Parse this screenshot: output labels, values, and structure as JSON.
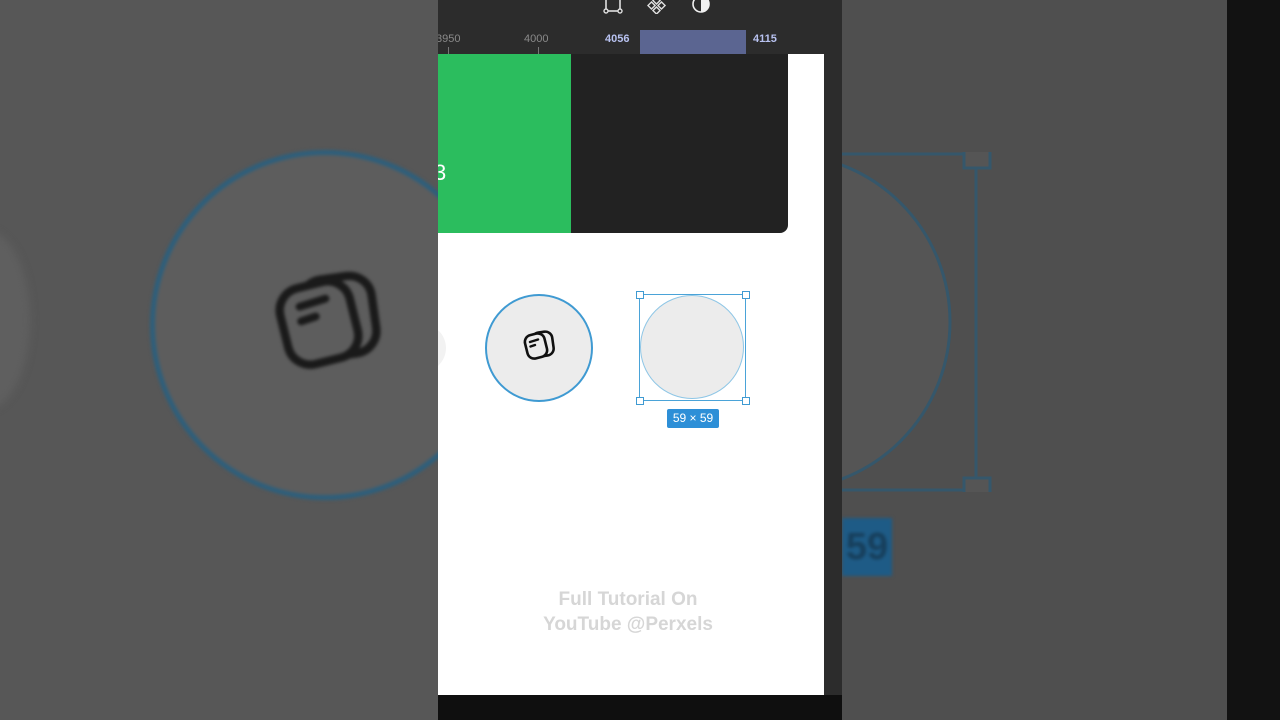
{
  "ruler": {
    "ticks": [
      "3950",
      "4000",
      "4056",
      "4115"
    ]
  },
  "card": {
    "green_number": "3"
  },
  "selection": {
    "size_label": "59 × 59"
  },
  "watermark": {
    "line1": "Full Tutorial On",
    "line2": "YouTube @Perxels"
  },
  "background": {
    "badge_text": "59"
  },
  "toolbar": {
    "icons": [
      "frame-tool-icon",
      "component-icon",
      "contrast-icon"
    ]
  },
  "colors": {
    "accent": "#3f9ad2",
    "green": "#2bbd5e",
    "dark_card": "#222222",
    "badge": "#2d8fd7",
    "ruler_selection": "#5b6591"
  }
}
